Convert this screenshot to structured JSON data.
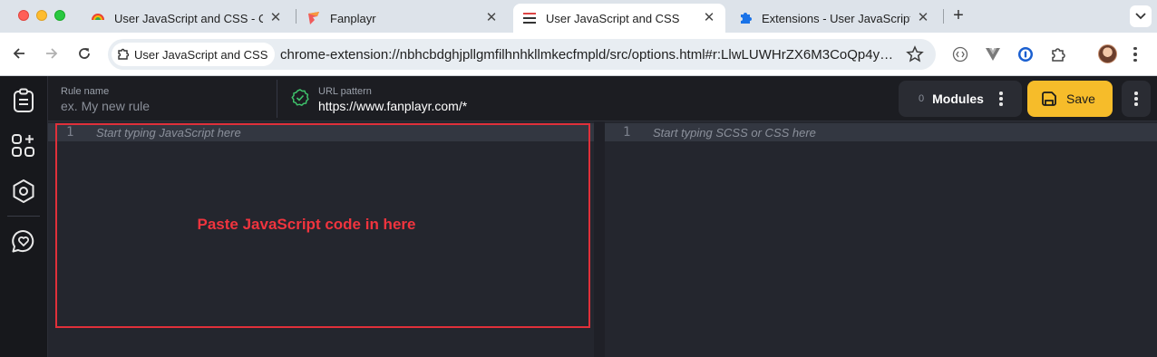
{
  "browser": {
    "tabs": [
      {
        "title": "User JavaScript and CSS - Chrome Web Store",
        "active": false
      },
      {
        "title": "Fanplayr",
        "active": false
      },
      {
        "title": "User JavaScript and CSS",
        "active": true
      },
      {
        "title": "Extensions - User JavaScript and CSS",
        "active": false
      }
    ],
    "site_chip": "User JavaScript and CSS",
    "url": "chrome-extension://nbhcbdghjpllgmfilhnhkllmkecfmpld/src/options.html#r:LlwLUWHrZX6M3CoQp4y…"
  },
  "colors": {
    "accent_save": "#f6bc2a",
    "annotation_red": "#e0303a",
    "app_bg": "#24262e",
    "sidebar_bg": "#17181c"
  },
  "sidebar": {
    "icons": [
      "rules-list-icon",
      "add-module-icon",
      "settings-hexagon-icon",
      "support-heart-icon"
    ]
  },
  "header": {
    "rule_name_label": "Rule name",
    "rule_name_placeholder": "ex. My new rule",
    "url_pattern_label": "URL pattern",
    "url_pattern_value": "https://www.fanplayr.com/*",
    "modules_count": "0",
    "modules_label": "Modules",
    "save_label": "Save"
  },
  "editors": {
    "js": {
      "line_number": "1",
      "placeholder": "Start typing JavaScript here"
    },
    "css": {
      "line_number": "1",
      "placeholder": "Start typing SCSS or CSS here"
    }
  },
  "annotation": {
    "text": "Paste JavaScript code in here"
  }
}
